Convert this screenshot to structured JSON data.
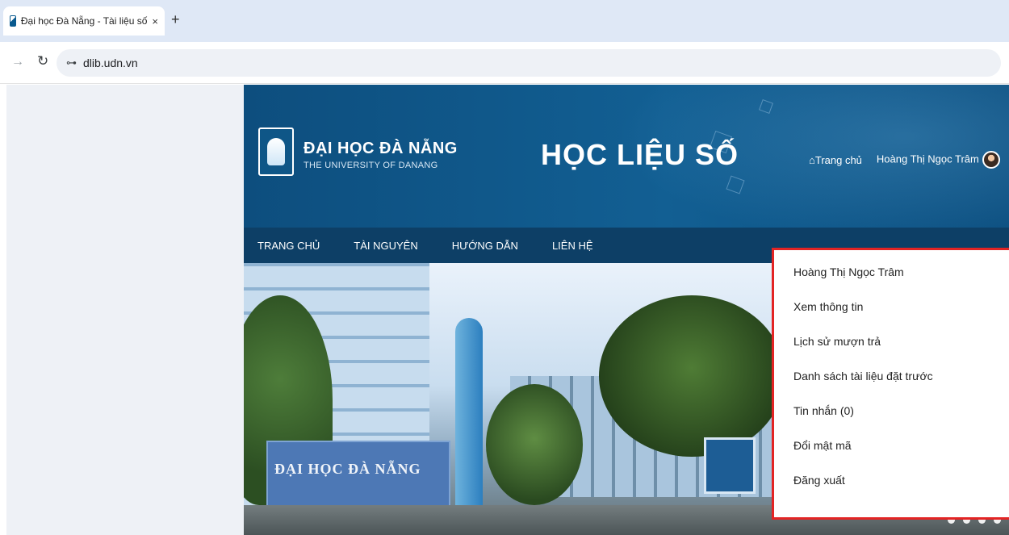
{
  "browser": {
    "tab": {
      "title": "Đại học Đà Nẵng - Tài liệu số",
      "close": "×"
    },
    "new_tab": "+",
    "url": "dlib.udn.vn"
  },
  "site": {
    "logo": {
      "name": "ĐẠI HỌC ĐÀ NẴNG",
      "subtitle": "THE UNIVERSITY OF DANANG"
    },
    "title": "HỌC LIỆU SỐ",
    "top_links": {
      "home": "Trang chủ",
      "user": "Hoàng Thị Ngọc Trâm"
    },
    "nav": [
      "TRANG CHỦ",
      "TÀI NGUYÊN",
      "HƯỚNG DẪN",
      "LIÊN HỆ"
    ],
    "hero": {
      "sign_text": "ĐẠI HỌC ĐÀ NẴNG",
      "carousel_dots": 4
    }
  },
  "dropdown": {
    "items": [
      "Hoàng Thị Ngọc Trâm",
      "Xem thông tin",
      "Lịch sử mượn trả",
      "Danh sách tài liệu đặt trước",
      "Tin nhắn (0)",
      "Đổi mật mã",
      "Đăng xuất"
    ],
    "highlight_color": "#e32424"
  },
  "colors": {
    "header_blue": "#125f93",
    "nav_blue": "#0d3f66"
  }
}
